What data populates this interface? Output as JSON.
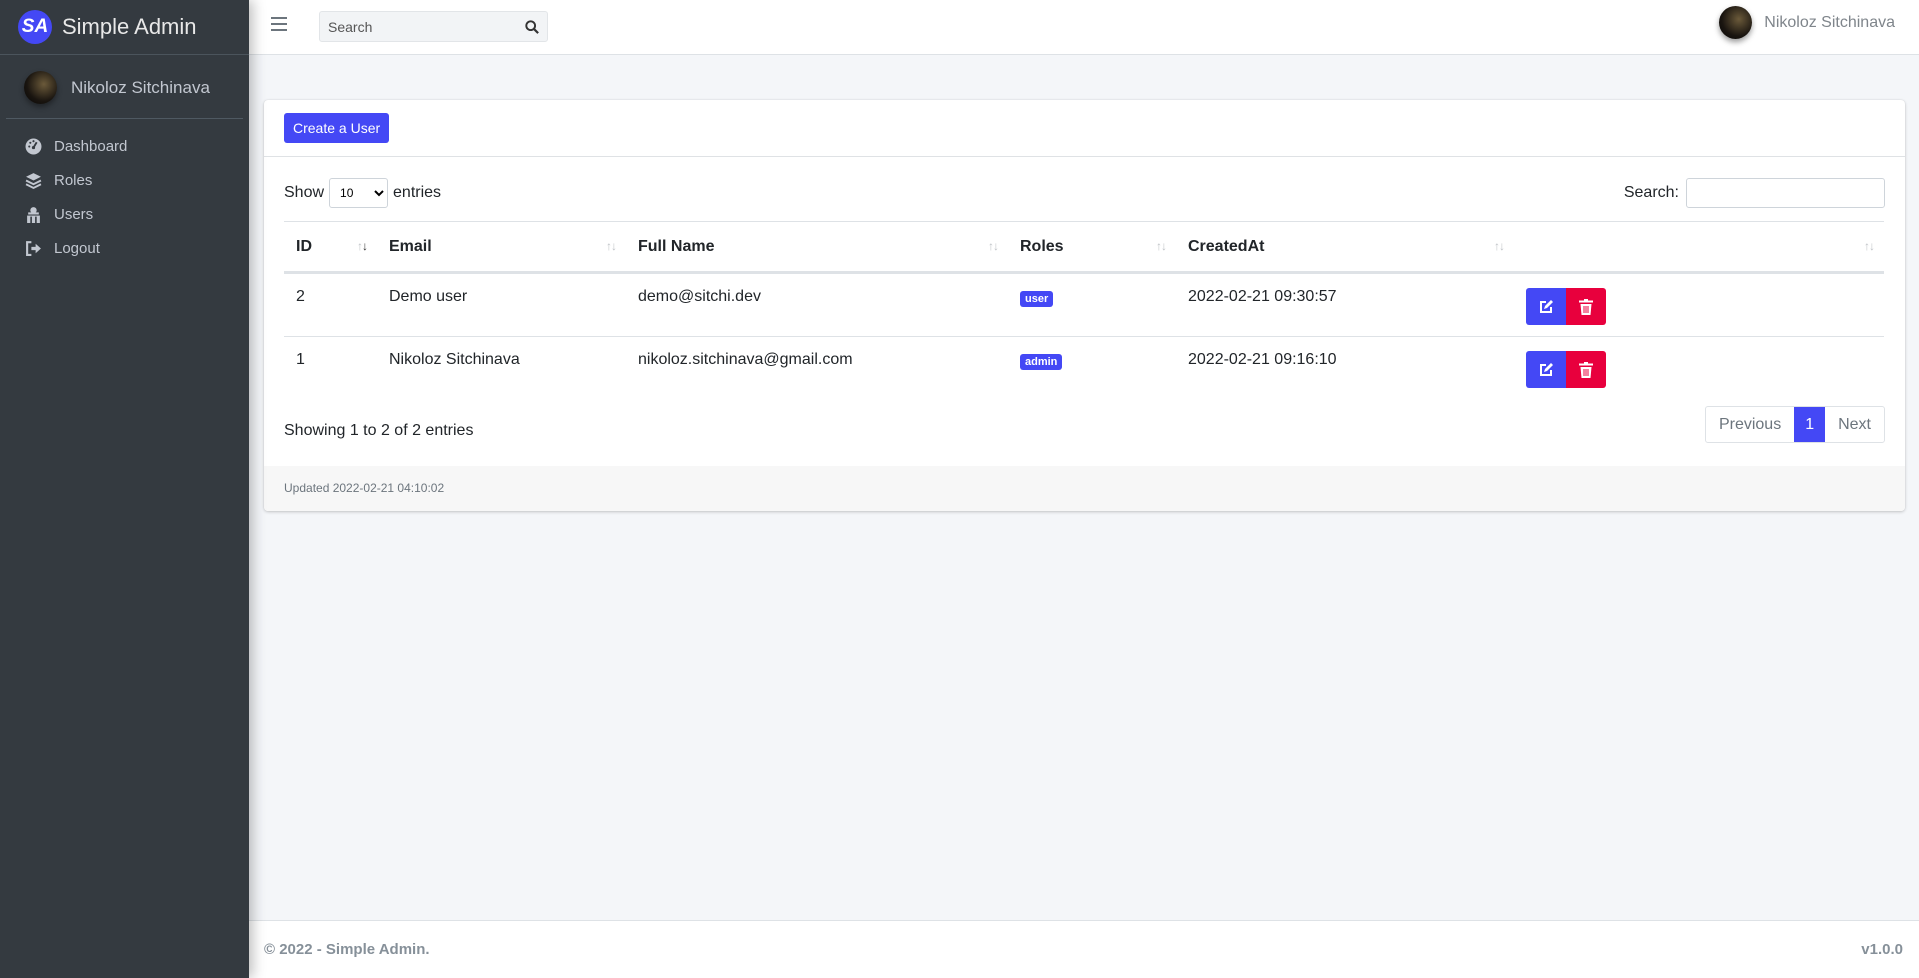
{
  "brand": {
    "logo_text": "SA",
    "name": "Simple Admin"
  },
  "sidebar": {
    "user_name": "Nikoloz Sitchinava",
    "items": [
      {
        "label": "Dashboard",
        "icon": "tachometer-icon"
      },
      {
        "label": "Roles",
        "icon": "layers-icon"
      },
      {
        "label": "Users",
        "icon": "users-icon"
      },
      {
        "label": "Logout",
        "icon": "sign-out-icon"
      }
    ]
  },
  "topbar": {
    "search_placeholder": "Search",
    "user_name": "Nikoloz Sitchinava"
  },
  "card": {
    "create_button": "Create a User",
    "show_label": "Show",
    "entries_label": "entries",
    "page_length": "10",
    "search_label": "Search:",
    "columns": [
      "ID",
      "Email",
      "Full Name",
      "Roles",
      "CreatedAt",
      ""
    ],
    "rows": [
      {
        "id": "2",
        "email": "Demo user",
        "full_name": "demo@sitchi.dev",
        "role": "user",
        "created_at": "2022-02-21 09:30:57"
      },
      {
        "id": "1",
        "email": "Nikoloz Sitchinava",
        "full_name": "nikoloz.sitchinava@gmail.com",
        "role": "admin",
        "created_at": "2022-02-21 09:16:10"
      }
    ],
    "info": "Showing 1 to 2 of 2 entries",
    "pagination": {
      "previous": "Previous",
      "current": "1",
      "next": "Next"
    },
    "updated": "Updated 2022-02-21 04:10:02"
  },
  "footer": {
    "copyright": "© 2022 - Simple Admin.",
    "version": "v1.0.0"
  },
  "colors": {
    "accent": "#4448f5",
    "danger": "#e8003d",
    "sidebar": "#343a40"
  }
}
